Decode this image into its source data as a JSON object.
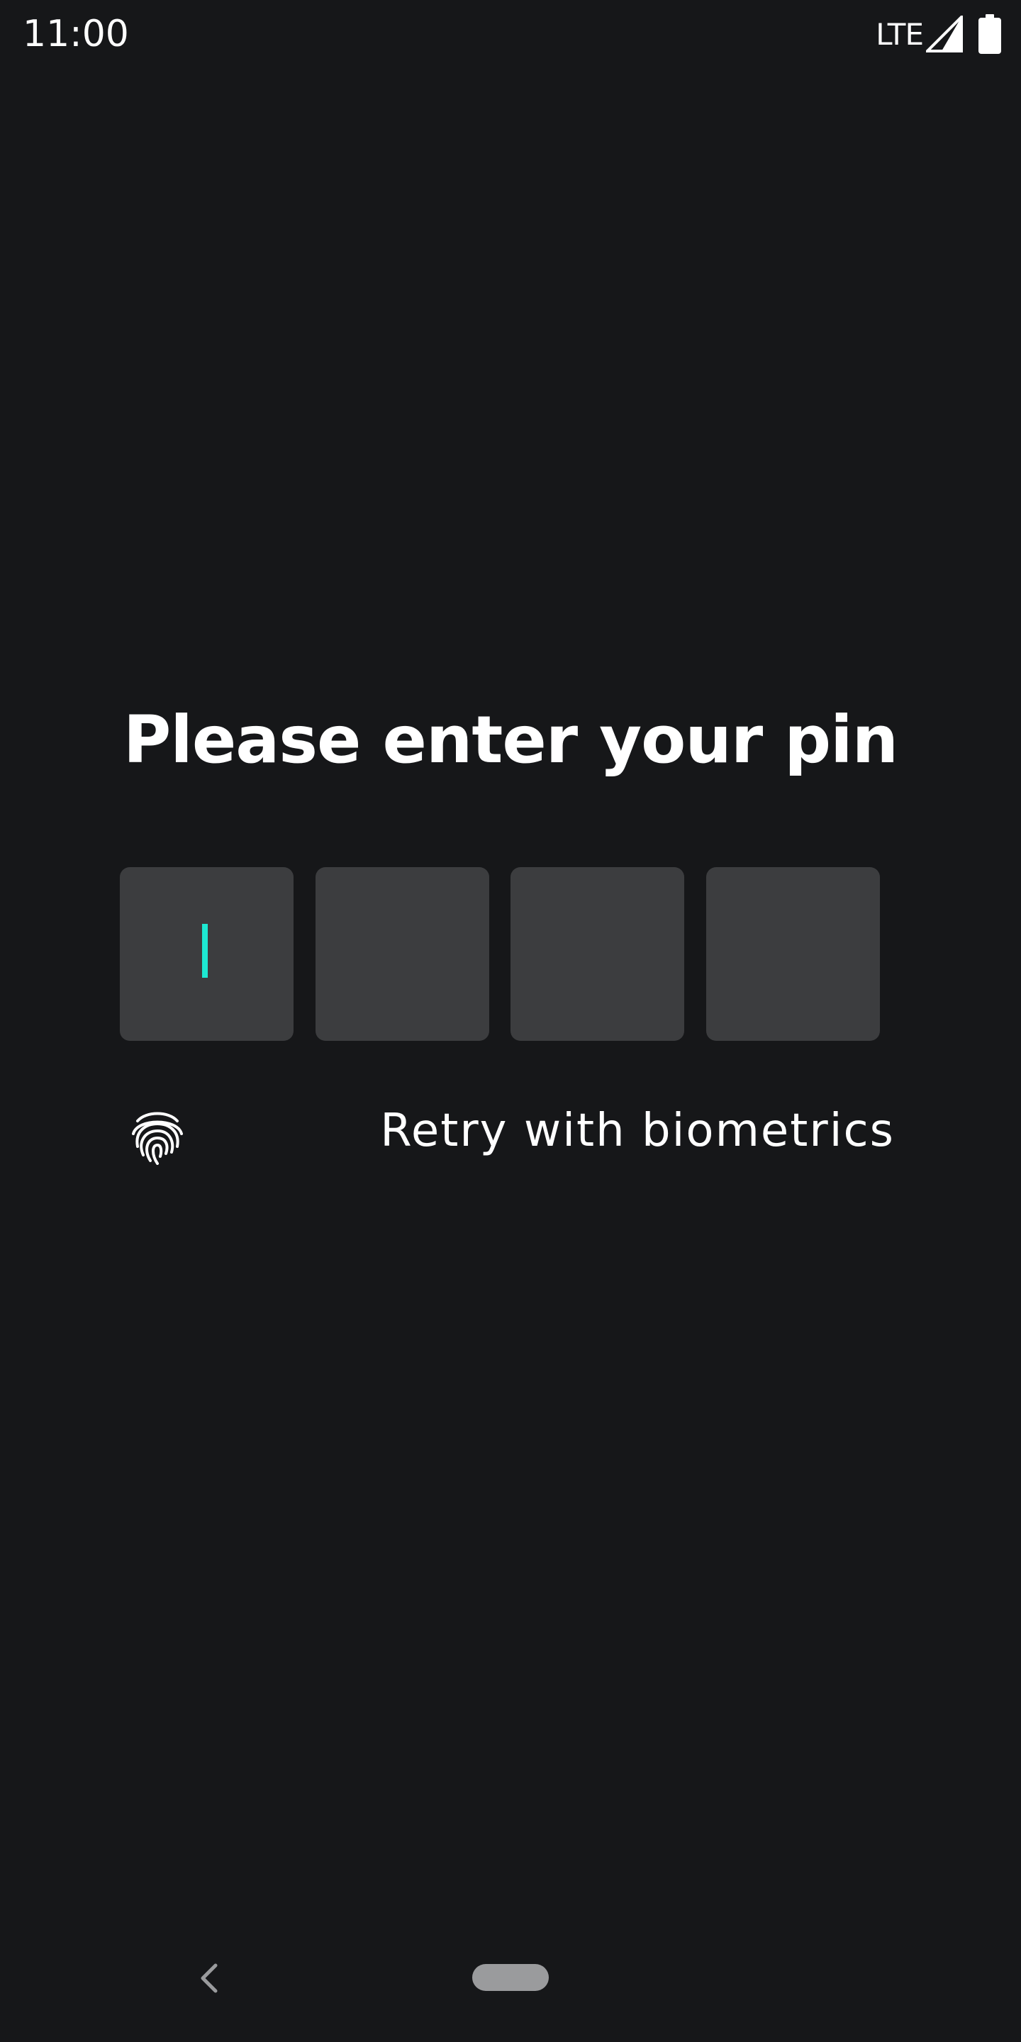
{
  "status_bar": {
    "time": "11:00",
    "network": "LTE",
    "icons": [
      "signal-icon",
      "battery-icon"
    ]
  },
  "screen": {
    "title": "Please enter your pin",
    "pin_length": 4,
    "active_box": 1,
    "cursor_color": "#1de9d2",
    "box_color": "#3c3d3f",
    "background": "#161719",
    "biometric": {
      "icon": "fingerprint-icon",
      "label": "Retry with biometrics"
    }
  },
  "nav_bar": {
    "icons": [
      "back-icon",
      "home-pill"
    ]
  }
}
